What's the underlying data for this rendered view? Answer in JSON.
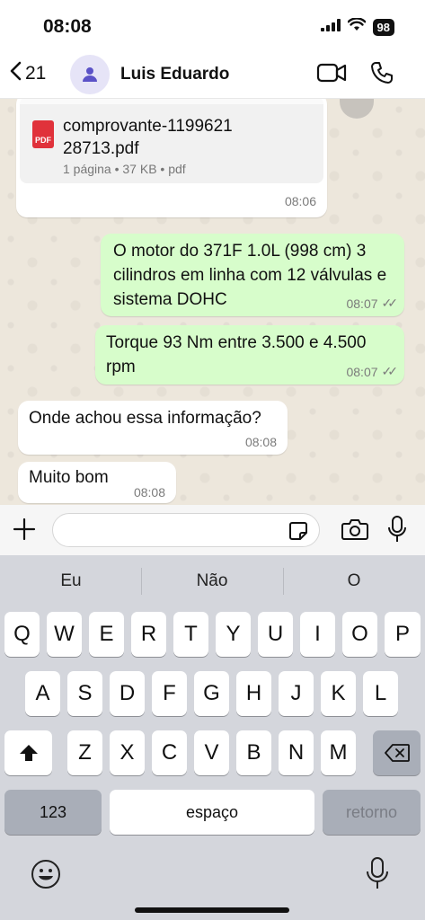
{
  "status": {
    "time": "08:08",
    "battery": "98"
  },
  "header": {
    "back_count": "21",
    "contact_name": "Luis Eduardo"
  },
  "messages": [
    {
      "type": "file",
      "direction": "incoming",
      "file_name": "comprovante-119962128713.pdf",
      "file_name_line1": "comprovante-1199621",
      "file_name_line2": "28713.pdf",
      "file_meta": "1 página • 37 KB • pdf",
      "pdf_label": "PDF",
      "time": "08:06"
    },
    {
      "type": "text",
      "direction": "outgoing",
      "text": "O motor do 371F 1.0L (998 cm) 3 cilindros em linha com 12 válvulas e sistema DOHC",
      "time": "08:07",
      "status": "read"
    },
    {
      "type": "text",
      "direction": "outgoing",
      "text": "Torque 93 Nm entre 3.500 e 4.500 rpm",
      "time": "08:07",
      "status": "read"
    },
    {
      "type": "text",
      "direction": "incoming",
      "text": "Onde achou essa informação?",
      "time": "08:08"
    },
    {
      "type": "text",
      "direction": "incoming",
      "text": "Muito bom",
      "time": "08:08"
    }
  ],
  "input": {
    "placeholder": ""
  },
  "keyboard": {
    "suggestions": [
      "Eu",
      "Não",
      "O"
    ],
    "row1": [
      "Q",
      "W",
      "E",
      "R",
      "T",
      "Y",
      "U",
      "I",
      "O",
      "P"
    ],
    "row2": [
      "A",
      "S",
      "D",
      "F",
      "G",
      "H",
      "J",
      "K",
      "L"
    ],
    "row3": [
      "Z",
      "X",
      "C",
      "V",
      "B",
      "N",
      "M"
    ],
    "numbers_label": "123",
    "space_label": "espaço",
    "return_label": "retorno"
  },
  "colors": {
    "outgoing_bubble": "#d7fdcb",
    "incoming_bubble": "#ffffff",
    "chat_background": "#ede7dc",
    "pdf_red": "#e0323b"
  }
}
